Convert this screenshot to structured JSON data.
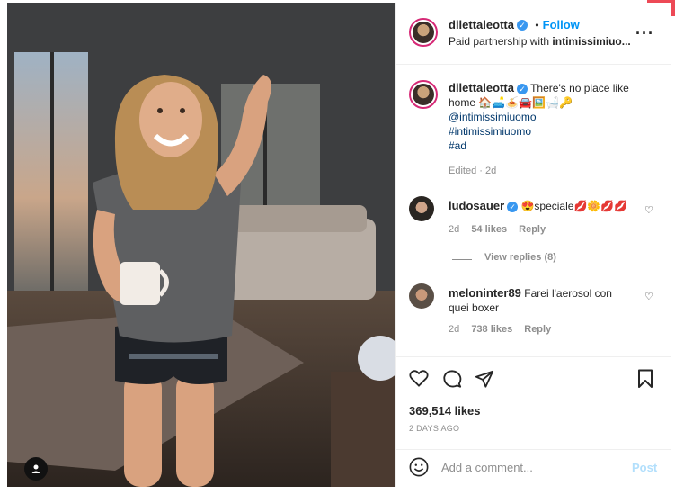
{
  "header": {
    "username": "dilettaleotta",
    "dot": "•",
    "follow_label": "Follow",
    "subtitle_prefix": "Paid partnership with ",
    "partner": "intimissimiuo..."
  },
  "caption": {
    "username": "dilettaleotta",
    "text_line1": "There's no place like",
    "text_line2": "home 🏠🛋️🍝🚘🖼️🛁🔑",
    "mention": "@intimissimiuomo",
    "hashtag1": "#intimissimiuomo",
    "hashtag2": "#ad",
    "edited": "Edited · 2d"
  },
  "comments": [
    {
      "username": "ludosauer",
      "text": "😍speciale💋🌼💋💋",
      "age": "2d",
      "likes": "54 likes",
      "reply": "Reply",
      "view_replies": "View replies (8)"
    },
    {
      "username": "meloninter89",
      "text_line1": "Farei l'aerosol con",
      "text_line2": "quei boxer",
      "age": "2d",
      "likes": "738 likes",
      "reply": "Reply"
    }
  ],
  "post": {
    "likes": "369,514 likes",
    "time": "2 DAYS AGO"
  },
  "composer": {
    "placeholder": "Add a comment...",
    "post_label": "Post"
  },
  "colors": {
    "accent": "#0095f6",
    "post_disabled": "#b2dffc",
    "notification": "#ed4956"
  }
}
